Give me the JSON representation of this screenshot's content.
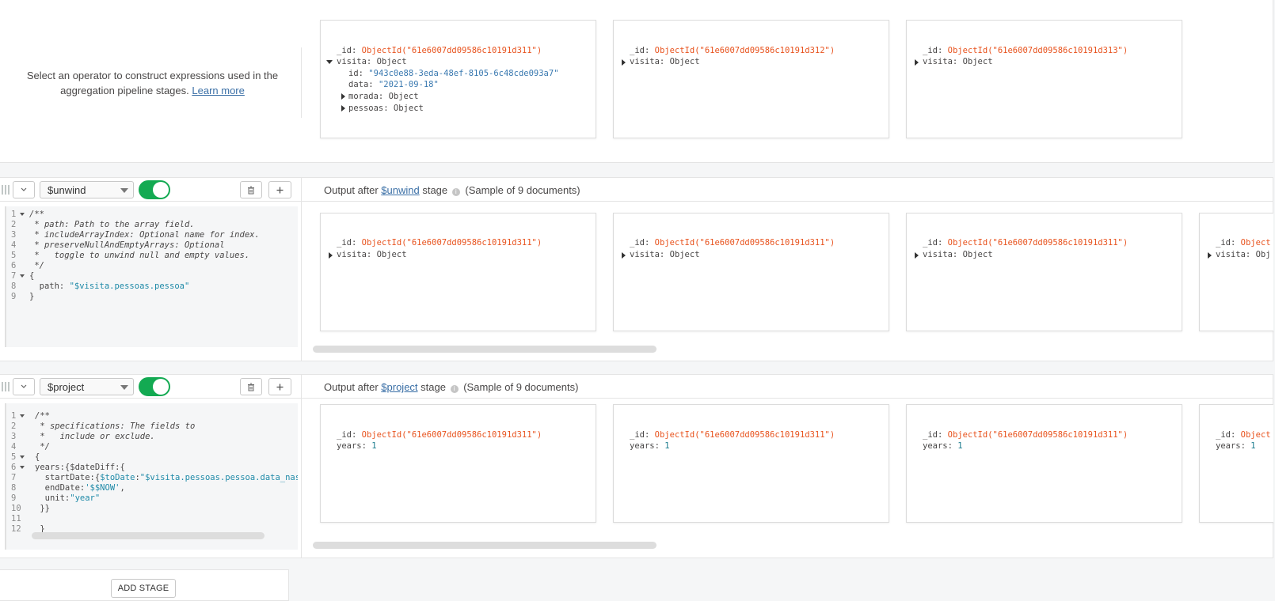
{
  "operator_hint": {
    "text": "Select an operator to construct expressions used in the aggregation pipeline stages.",
    "link": "Learn more"
  },
  "stage0": {
    "docs": [
      {
        "id_key": "_id:",
        "id_val": "ObjectId(\"61e6007dd09586c10191d311\")",
        "visita_key": "visita:",
        "visita_val": "Object",
        "expanded": [
          {
            "key": "id:",
            "val": "\"943c0e88-3eda-48ef-8105-6c48cde093a7\"",
            "kind": "str"
          },
          {
            "key": "data:",
            "val": "\"2021-09-18\"",
            "kind": "str"
          },
          {
            "key": "morada:",
            "val": "Object",
            "kind": "obj"
          },
          {
            "key": "pessoas:",
            "val": "Object",
            "kind": "obj"
          }
        ]
      },
      {
        "id_key": "_id:",
        "id_val": "ObjectId(\"61e6007dd09586c10191d312\")",
        "visita_key": "visita:",
        "visita_val": "Object"
      },
      {
        "id_key": "_id:",
        "id_val": "ObjectId(\"61e6007dd09586c10191d313\")",
        "visita_key": "visita:",
        "visita_val": "Object"
      }
    ]
  },
  "stage1": {
    "operator": "$unwind",
    "output_prefix": "Output after",
    "output_link": "$unwind",
    "output_suffix": "stage",
    "sample": "(Sample of 9 documents)",
    "code": [
      {
        "n": "1",
        "fold": true,
        "text": "/**",
        "kind": "cmt"
      },
      {
        "n": "2",
        "text": " * path: Path to the array field.",
        "kind": "cmt"
      },
      {
        "n": "3",
        "text": " * includeArrayIndex: Optional name for index.",
        "kind": "cmt"
      },
      {
        "n": "4",
        "text": " * preserveNullAndEmptyArrays: Optional",
        "kind": "cmt"
      },
      {
        "n": "5",
        "text": " *   toggle to unwind null and empty values.",
        "kind": "cmt"
      },
      {
        "n": "6",
        "text": " */",
        "kind": "cmt"
      },
      {
        "n": "7",
        "fold": true,
        "text": "{",
        "kind": "plain"
      },
      {
        "n": "8",
        "text": "  path: ",
        "kind": "plain",
        "str": "\"$visita.pessoas.pessoa\""
      },
      {
        "n": "9",
        "text": "}",
        "kind": "plain"
      }
    ],
    "docs": [
      {
        "id_key": "_id:",
        "id_val": "ObjectId(\"61e6007dd09586c10191d311\")",
        "visita_key": "visita:",
        "visita_val": "Object"
      },
      {
        "id_key": "_id:",
        "id_val": "ObjectId(\"61e6007dd09586c10191d311\")",
        "visita_key": "visita:",
        "visita_val": "Object"
      },
      {
        "id_key": "_id:",
        "id_val": "ObjectId(\"61e6007dd09586c10191d311\")",
        "visita_key": "visita:",
        "visita_val": "Object"
      },
      {
        "id_key": "_id:",
        "id_val": "Object",
        "visita_key": "visita:",
        "visita_val": "Obj"
      }
    ]
  },
  "stage2": {
    "operator": "$project",
    "output_prefix": "Output after",
    "output_link": "$project",
    "output_suffix": "stage",
    "sample": "(Sample of 9 documents)",
    "code": [
      {
        "n": "1",
        "fold": true,
        "text": "/**",
        "kind": "cmt"
      },
      {
        "n": "2",
        "text": " * specifications: The fields to",
        "kind": "cmt"
      },
      {
        "n": "3",
        "text": " *   include or exclude.",
        "kind": "cmt"
      },
      {
        "n": "4",
        "text": " */",
        "kind": "cmt"
      },
      {
        "n": "5",
        "fold": true,
        "text": "{",
        "kind": "plain"
      },
      {
        "n": "6",
        "fold": true,
        "text": "years:{$dateDiff:{",
        "kind": "plain"
      },
      {
        "n": "7",
        "text": "  startDate:{",
        "kind": "plain",
        "fn": "$toDate",
        "after": ":",
        "str": "\"$visita.pessoas.pessoa.data_nascimento\""
      },
      {
        "n": "8",
        "text": "  endDate:",
        "kind": "plain",
        "str": "'$$NOW'",
        "tail": ","
      },
      {
        "n": "9",
        "text": "  unit:",
        "kind": "plain",
        "str": "\"year\""
      },
      {
        "n": "10",
        "text": " }}",
        "kind": "plain"
      },
      {
        "n": "11",
        "text": "",
        "kind": "plain"
      },
      {
        "n": "12",
        "text": " }",
        "kind": "plain"
      }
    ],
    "docs": [
      {
        "id_key": "_id:",
        "id_val": "ObjectId(\"61e6007dd09586c10191d311\")",
        "years_key": "years:",
        "years_val": "1"
      },
      {
        "id_key": "_id:",
        "id_val": "ObjectId(\"61e6007dd09586c10191d311\")",
        "years_key": "years:",
        "years_val": "1"
      },
      {
        "id_key": "_id:",
        "id_val": "ObjectId(\"61e6007dd09586c10191d311\")",
        "years_key": "years:",
        "years_val": "1"
      },
      {
        "id_key": "_id:",
        "id_val": "Object",
        "years_key": "years:",
        "years_val": "1"
      }
    ]
  },
  "add_stage": "ADD STAGE"
}
